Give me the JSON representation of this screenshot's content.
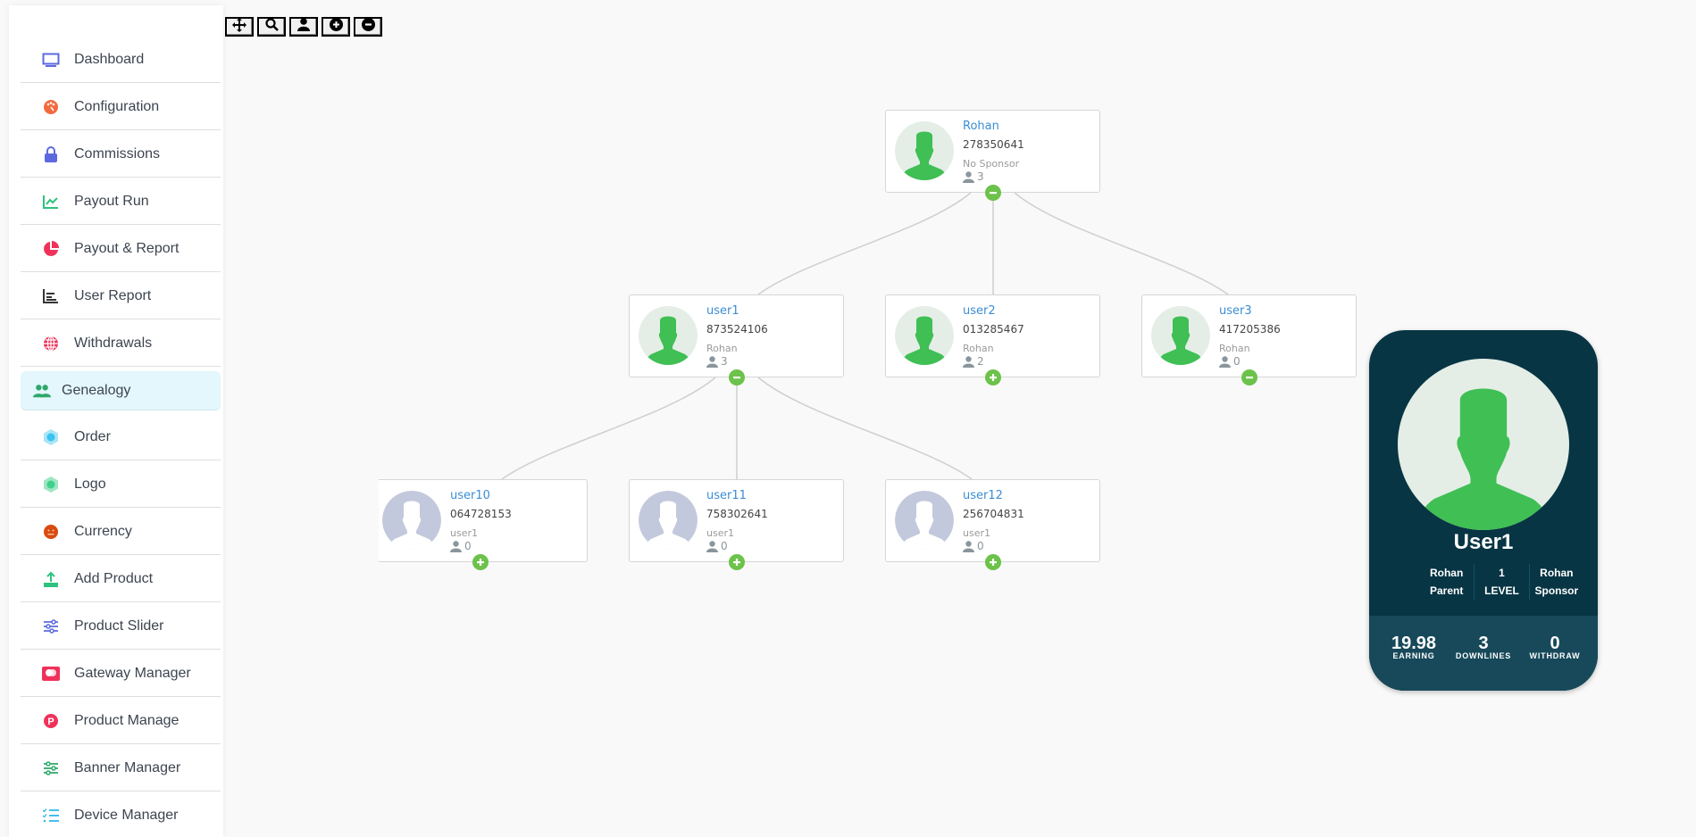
{
  "sidebar": {
    "items": [
      {
        "label": "Dashboard",
        "icon": "monitor-icon",
        "color": "#5c6ae0"
      },
      {
        "label": "Configuration",
        "icon": "palette-icon",
        "color": "#f26a3f"
      },
      {
        "label": "Commissions",
        "icon": "lock-icon",
        "color": "#5c6ae0"
      },
      {
        "label": "Payout Run",
        "icon": "line-chart-icon",
        "color": "#2ec27e"
      },
      {
        "label": "Payout & Report",
        "icon": "pie-chart-icon",
        "color": "#f0325a"
      },
      {
        "label": "User Report",
        "icon": "bar-list-icon",
        "color": "#333333"
      },
      {
        "label": "Withdrawals",
        "icon": "globe-icon",
        "color": "#f0325a"
      },
      {
        "label": "Genealogy",
        "icon": "users-icon",
        "color": "#2ea86a",
        "active": true
      },
      {
        "label": "Order",
        "icon": "snowflake-icon",
        "color": "#3ac3f0"
      },
      {
        "label": "Logo",
        "icon": "hexagon-icon",
        "color": "#3fd08a"
      },
      {
        "label": "Currency",
        "icon": "face-icon",
        "color": "#d94a10"
      },
      {
        "label": "Add Product",
        "icon": "upload-icon",
        "color": "#2ec27e"
      },
      {
        "label": "Product Slider",
        "icon": "sliders-icon",
        "color": "#5c6ae0"
      },
      {
        "label": "Gateway Manager",
        "icon": "card-icon",
        "color": "#f0325a"
      },
      {
        "label": "Product Manage",
        "icon": "p-circle-icon",
        "color": "#f0325a"
      },
      {
        "label": "Banner Manager",
        "icon": "sliders-icon",
        "color": "#2ea86a"
      },
      {
        "label": "Device Manager",
        "icon": "checklist-icon",
        "color": "#2ab8e8"
      }
    ]
  },
  "toolbar": {
    "buttons": [
      "move-icon",
      "search-icon",
      "user-icon",
      "zoom-in-icon",
      "zoom-out-icon"
    ]
  },
  "tree": {
    "nodes": {
      "rohan": {
        "name": "Rohan",
        "id": "278350641",
        "sponsor": "No Sponsor",
        "count": "3",
        "expanded": true,
        "active": true
      },
      "user1": {
        "name": "user1",
        "id": "873524106",
        "sponsor": "Rohan",
        "count": "3",
        "expanded": true,
        "active": true
      },
      "user2": {
        "name": "user2",
        "id": "013285467",
        "sponsor": "Rohan",
        "count": "2",
        "expanded": false,
        "active": true
      },
      "user3": {
        "name": "user3",
        "id": "417205386",
        "sponsor": "Rohan",
        "count": "0",
        "expanded": true,
        "active": true
      },
      "user10": {
        "name": "user10",
        "id": "064728153",
        "sponsor": "user1",
        "count": "0",
        "expanded": false,
        "active": false
      },
      "user11": {
        "name": "user11",
        "id": "758302641",
        "sponsor": "user1",
        "count": "0",
        "expanded": false,
        "active": false
      },
      "user12": {
        "name": "user12",
        "id": "256704831",
        "sponsor": "user1",
        "count": "0",
        "expanded": false,
        "active": false
      }
    }
  },
  "profile": {
    "name": "User1",
    "parent": "Rohan",
    "parent_label": "Parent",
    "level": "1",
    "level_label": "LEVEL",
    "sponsor": "Rohan",
    "sponsor_label": "Sponsor",
    "earning": "19.98",
    "earning_label": "EARNING",
    "downlines": "3",
    "downlines_label": "DOWNLINES",
    "withdraw": "0",
    "withdraw_label": "WITHDRAW"
  },
  "colors": {
    "active_avatar": "#3fbf54",
    "inactive_avatar": "#c3c9dc",
    "toggle": "#6cc24a",
    "card_bg": "#083544",
    "card_stats_bg": "#17495a",
    "link": "#3b8ed4"
  }
}
